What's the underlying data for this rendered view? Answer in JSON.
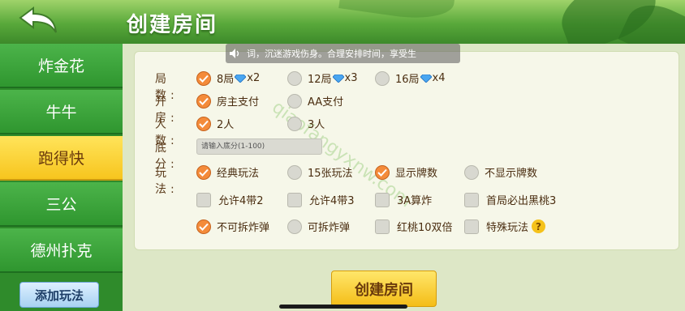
{
  "header": {
    "title": "创建房间"
  },
  "sidebar": {
    "items": [
      {
        "label": "炸金花"
      },
      {
        "label": "牛牛"
      },
      {
        "label": "跑得快"
      },
      {
        "label": "三公"
      },
      {
        "label": "德州扑克"
      }
    ],
    "add_label": "添加玩法"
  },
  "notice": {
    "text": "词，沉迷游戏伤身。合理安排时间，享受生"
  },
  "form": {
    "rounds": {
      "label": "局  数:",
      "options": [
        {
          "label": "8局",
          "multiplier": "x2",
          "selected": true
        },
        {
          "label": "12局",
          "multiplier": "x3",
          "selected": false
        },
        {
          "label": "16局",
          "multiplier": "x4",
          "selected": false
        }
      ]
    },
    "room": {
      "label": "开  房:",
      "options": [
        {
          "label": "房主支付",
          "selected": true
        },
        {
          "label": "AA支付",
          "selected": false
        }
      ]
    },
    "players": {
      "label": "人  数:",
      "options": [
        {
          "label": "2人",
          "selected": true
        },
        {
          "label": "3人",
          "selected": false
        }
      ]
    },
    "base": {
      "label": "底  分:",
      "placeholder": "请输入底分(1-100)"
    },
    "play": {
      "label": "玩  法:",
      "row1": [
        {
          "label": "经典玩法",
          "selected": true
        },
        {
          "label": "15张玩法",
          "selected": false
        },
        {
          "label": "显示牌数",
          "selected": true
        },
        {
          "label": "不显示牌数",
          "selected": false
        }
      ],
      "row2": [
        {
          "label": "允许4带2"
        },
        {
          "label": "允许4带3"
        },
        {
          "label": "3A算炸"
        },
        {
          "label": "首局必出黑桃3"
        }
      ],
      "row3": [
        {
          "label": "不可拆炸弹",
          "selected": true
        },
        {
          "label": "可拆炸弹",
          "selected": false
        },
        {
          "label": "红桃10双倍"
        },
        {
          "label": "特殊玩法"
        }
      ],
      "help": "?"
    }
  },
  "create_label": "创建房间",
  "watermark": "qiaofangyxnw.com",
  "colors": {
    "accent": "#f48b3a",
    "sidebar": "#2f962f",
    "active": "#f7c51e"
  }
}
